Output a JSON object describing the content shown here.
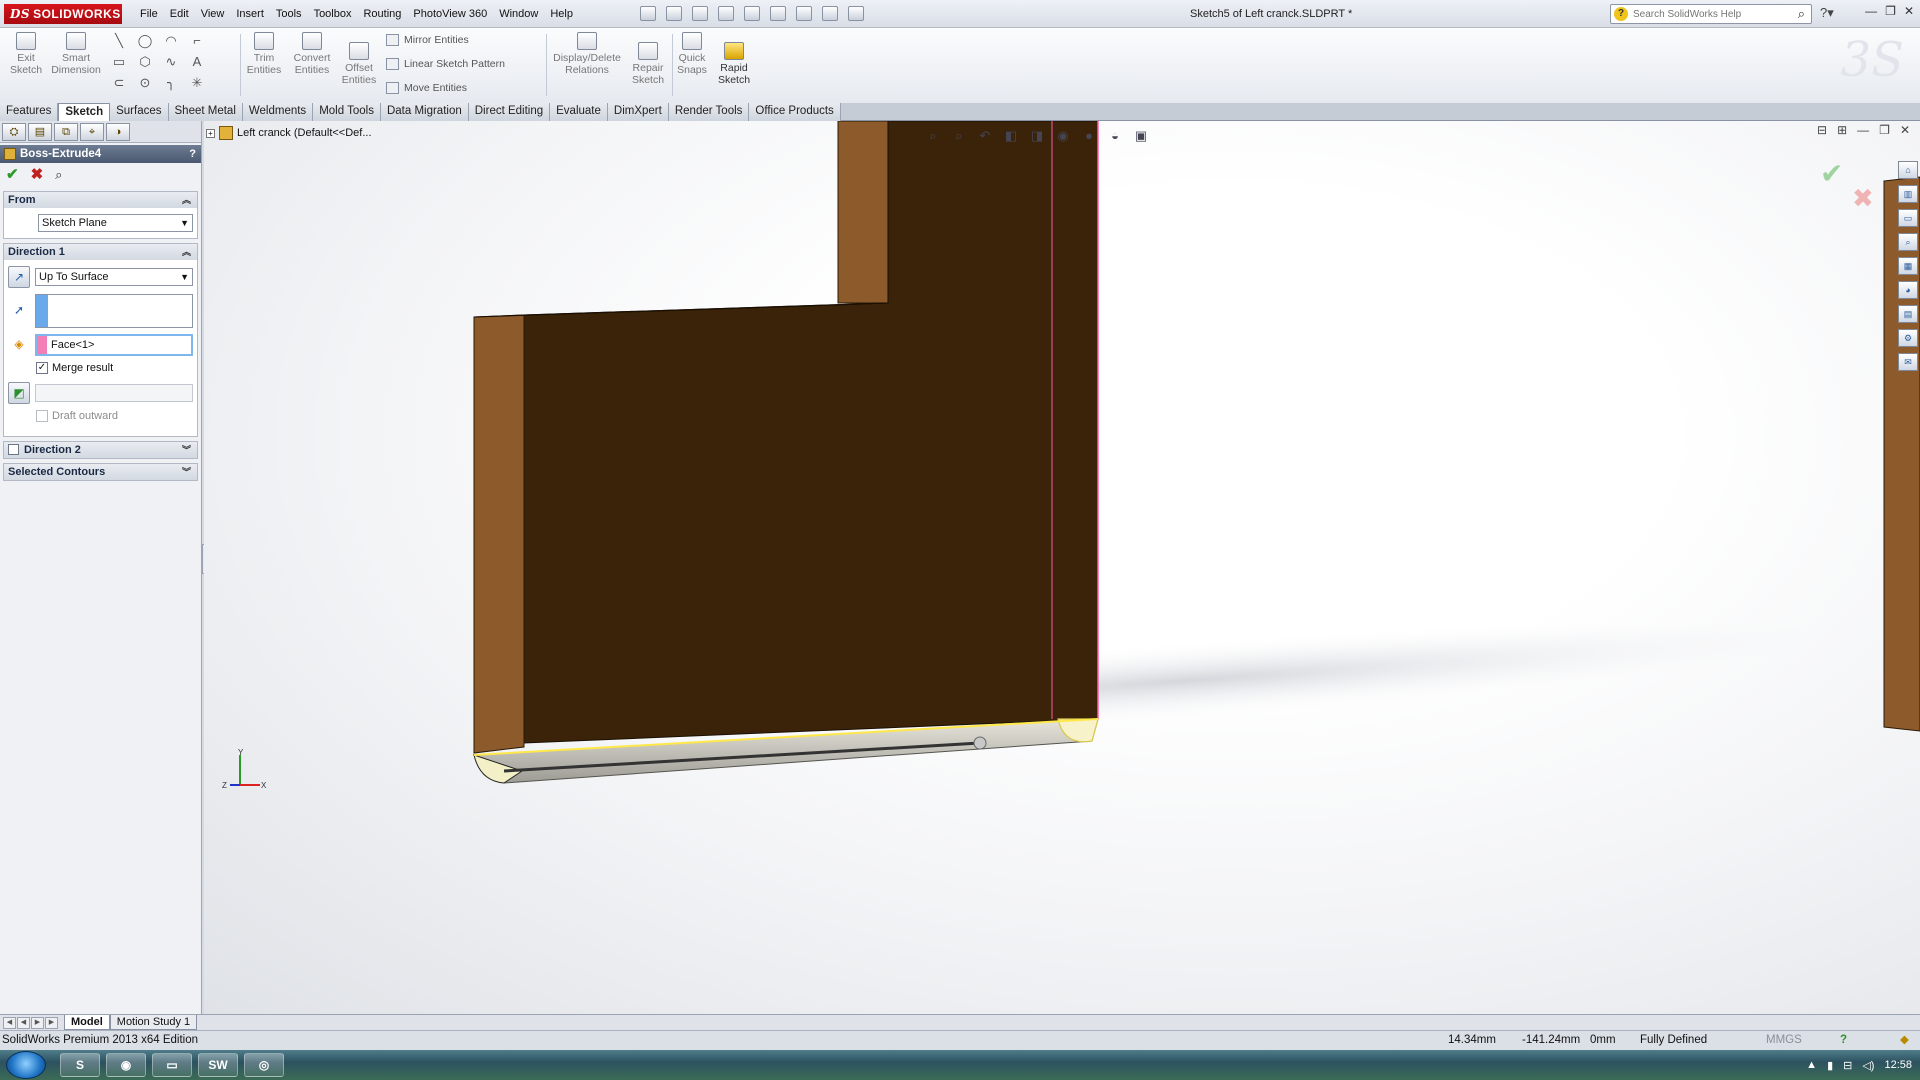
{
  "app": {
    "logo_text": "SOLIDWORKS",
    "document_title": "Sketch5 of Left cranck.SLDPRT *"
  },
  "menu": [
    "File",
    "Edit",
    "View",
    "Insert",
    "Tools",
    "Toolbox",
    "Routing",
    "PhotoView 360",
    "Window",
    "Help"
  ],
  "search": {
    "placeholder": "Search SolidWorks Help"
  },
  "commands": {
    "exit_sketch": "Exit Sketch",
    "smart_dimension": "Smart Dimension",
    "trim_entities": "Trim Entities",
    "convert_entities": "Convert Entities",
    "offset_entities": "Offset Entities",
    "mirror_entities": "Mirror Entities",
    "linear_pattern": "Linear Sketch Pattern",
    "move_entities": "Move Entities",
    "display_relations": "Display/Delete Relations",
    "repair_sketch": "Repair Sketch",
    "quick_snaps": "Quick Snaps",
    "rapid_sketch": "Rapid Sketch"
  },
  "tabs": [
    "Features",
    "Sketch",
    "Surfaces",
    "Sheet Metal",
    "Weldments",
    "Mold Tools",
    "Data Migration",
    "Direct Editing",
    "Evaluate",
    "DimXpert",
    "Render Tools",
    "Office Products"
  ],
  "active_tab": "Sketch",
  "property_manager": {
    "title": "Boss-Extrude4",
    "help": "?",
    "from": {
      "heading": "From",
      "value": "Sketch Plane"
    },
    "direction1": {
      "heading": "Direction 1",
      "end_condition": "Up To Surface",
      "face_value": "Face<1>",
      "merge_result_label": "Merge result",
      "merge_result_checked": true,
      "draft_outward_label": "Draft outward",
      "draft_outward_checked": false
    },
    "direction2": {
      "heading": "Direction 2"
    },
    "selected_contours": {
      "heading": "Selected Contours"
    }
  },
  "graphics": {
    "tree_label": "Left cranck  (Default<<Def...",
    "triad": {
      "y": "Y",
      "x": "X",
      "z": "Z"
    },
    "colors": {
      "body_face": "#3a2308",
      "body_side": "#8c5a2b",
      "selected_edge": "#ffe84a",
      "sketch_edge": "#ff5aa8"
    }
  },
  "model_tabs": [
    "Model",
    "Motion Study 1"
  ],
  "active_model_tab": "Model",
  "status": {
    "edition": "SolidWorks Premium 2013 x64 Edition",
    "x_coord": "14.34mm",
    "y_coord": "-141.24mm",
    "z_coord": "0mm",
    "sketch_state": "Fully Defined",
    "units": "MMGS"
  },
  "taskbar": {
    "clock": "12:58"
  }
}
